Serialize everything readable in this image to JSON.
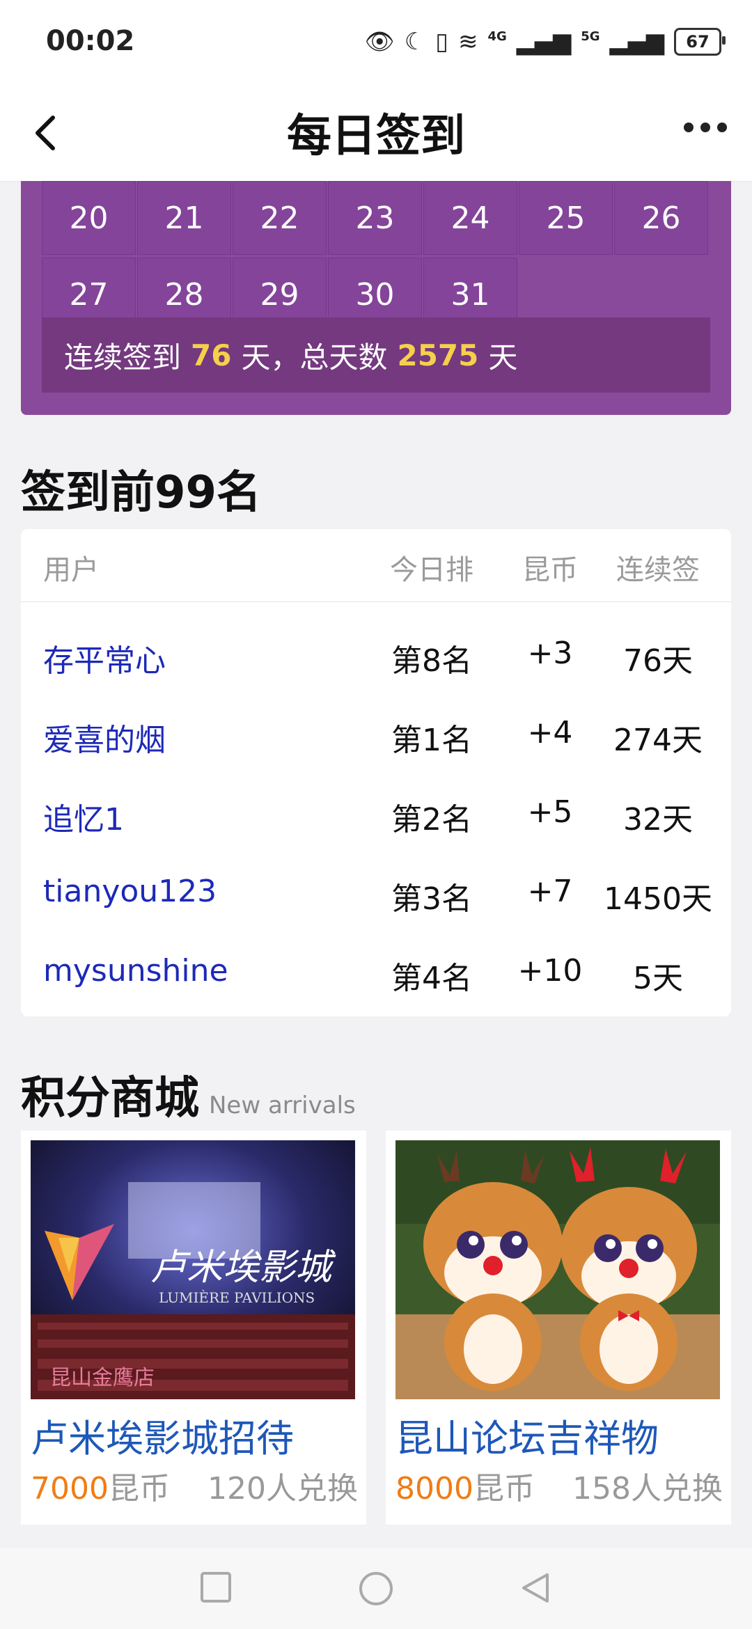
{
  "status_bar": {
    "time": "00:02",
    "net1": "4G",
    "net2": "5G",
    "battery": "67"
  },
  "header": {
    "title": "每日签到"
  },
  "calendar": {
    "rows": [
      [
        "20",
        "21",
        "22",
        "23",
        "24",
        "25",
        "26"
      ],
      [
        "27",
        "28",
        "29",
        "30",
        "31"
      ]
    ],
    "summary": {
      "prefix": "连续签到",
      "streak": "76",
      "mid": "天，总天数",
      "total": "2575",
      "suffix": "天"
    }
  },
  "ranking": {
    "title": "签到前99名",
    "headers": {
      "user": "用户",
      "today": "今日排",
      "coins": "昆币",
      "streak": "连续签"
    },
    "rows": [
      {
        "user": "存平常心",
        "rank": "第8名",
        "coins": "+3",
        "streak": "76天"
      },
      {
        "user": "爱喜的烟",
        "rank": "第1名",
        "coins": "+4",
        "streak": "274天"
      },
      {
        "user": "追忆1",
        "rank": "第2名",
        "coins": "+5",
        "streak": "32天"
      },
      {
        "user": "tianyou123",
        "rank": "第3名",
        "coins": "+7",
        "streak": "1450天"
      },
      {
        "user": "mysunshine",
        "rank": "第4名",
        "coins": "+10",
        "streak": "5天"
      }
    ]
  },
  "shop": {
    "title": "积分商城",
    "subtitle": "New arrivals",
    "items": [
      {
        "name": "卢米埃影城招待",
        "price": "7000",
        "unit": "昆币",
        "exchanged": "120人兑换",
        "image_text": "卢米埃影城",
        "image_text_en": "LUMIÈRE PAVILIONS",
        "image_tag": "昆山金鹰店"
      },
      {
        "name": "昆山论坛吉祥物",
        "price": "8000",
        "unit": "昆币",
        "exchanged": "158人兑换"
      }
    ]
  },
  "colors": {
    "calendar_bg": "#8a4a9b",
    "highlight": "#f6cf4c",
    "link": "#1d29b8",
    "price": "#ef7d16"
  }
}
